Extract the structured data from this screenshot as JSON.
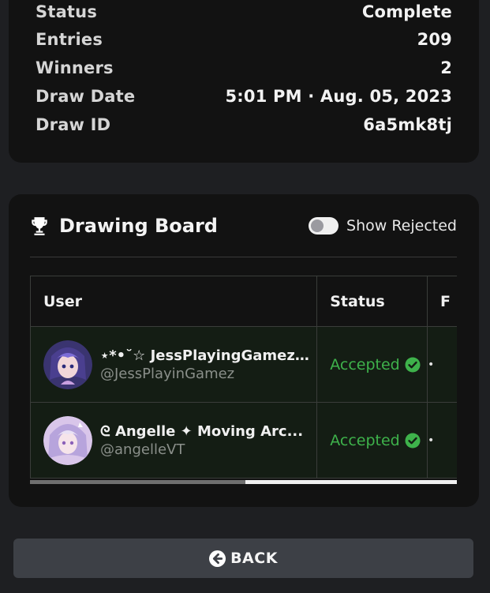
{
  "info": {
    "rows": [
      {
        "label": "Status",
        "value": "Complete"
      },
      {
        "label": "Entries",
        "value": "209"
      },
      {
        "label": "Winners",
        "value": "2"
      },
      {
        "label": "Draw Date",
        "value": "5:01 PM · Aug. 05, 2023"
      },
      {
        "label": "Draw ID",
        "value": "6a5mk8tj"
      }
    ]
  },
  "board": {
    "icon": "trophy-icon",
    "title": "Drawing Board",
    "toggle": {
      "label": "Show Rejected",
      "on": false
    },
    "columns": [
      "User",
      "Status",
      "F"
    ],
    "rows": [
      {
        "name": "⋆*•˘☆ JessPlayingGamez...",
        "handle": "@JessPlayinGamez",
        "status": "Accepted",
        "status_icon": "check-circle-icon",
        "extra": "•"
      },
      {
        "name": "ᘓ Angelle ✦ Moving Arc...",
        "handle": "@angelleVT",
        "status": "Accepted",
        "status_icon": "check-circle-icon",
        "extra": "•"
      }
    ],
    "scroll_position": 0.5
  },
  "back_button": {
    "label": "BACK",
    "icon": "arrow-left-circle-icon"
  },
  "colors": {
    "accepted": "#3eb24b",
    "card": "#121212",
    "background": "#1e1f22",
    "button": "#3d4046"
  }
}
